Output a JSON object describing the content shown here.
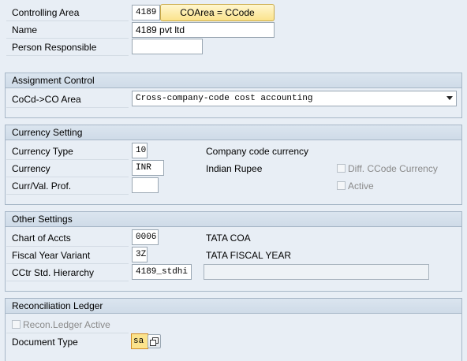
{
  "header": {
    "controlling_area": {
      "label": "Controlling Area",
      "value": "4189",
      "button": "COArea = CCode"
    },
    "name": {
      "label": "Name",
      "value": "4189 pvt ltd"
    },
    "person_responsible": {
      "label": "Person Responsible",
      "value": ""
    }
  },
  "assignment_control": {
    "title": "Assignment Control",
    "cocd_co_area": {
      "label": "CoCd->CO Area",
      "selected": "Cross-company-code cost accounting"
    }
  },
  "currency_setting": {
    "title": "Currency Setting",
    "currency_type": {
      "label": "Currency Type",
      "value": "10",
      "description": "Company code currency"
    },
    "currency": {
      "label": "Currency",
      "value": "INR",
      "description": "Indian Rupee"
    },
    "curr_val_prof": {
      "label": "Curr/Val. Prof.",
      "value": ""
    },
    "diff_ccode_currency": {
      "label": "Diff. CCode Currency",
      "checked": false
    },
    "active": {
      "label": "Active",
      "checked": false
    }
  },
  "other_settings": {
    "title": "Other Settings",
    "chart_of_accts": {
      "label": "Chart of Accts",
      "value": "0006",
      "description": "TATA COA"
    },
    "fiscal_year_variant": {
      "label": "Fiscal Year Variant",
      "value": "3Z",
      "description": "TATA FISCAL YEAR"
    },
    "cctr_std_hierarchy": {
      "label": "CCtr Std. Hierarchy",
      "value": "4189_stdhi",
      "description": ""
    }
  },
  "reconciliation_ledger": {
    "title": "Reconciliation Ledger",
    "recon_ledger_active": {
      "label": "Recon.Ledger Active",
      "checked": false
    },
    "document_type": {
      "label": "Document Type",
      "value": "sa"
    }
  },
  "colors": {
    "background": "#e8eef5",
    "group_header": "#d3dee9",
    "button_yellow": "#fbe38c",
    "focus_orange": "#d28a22"
  }
}
